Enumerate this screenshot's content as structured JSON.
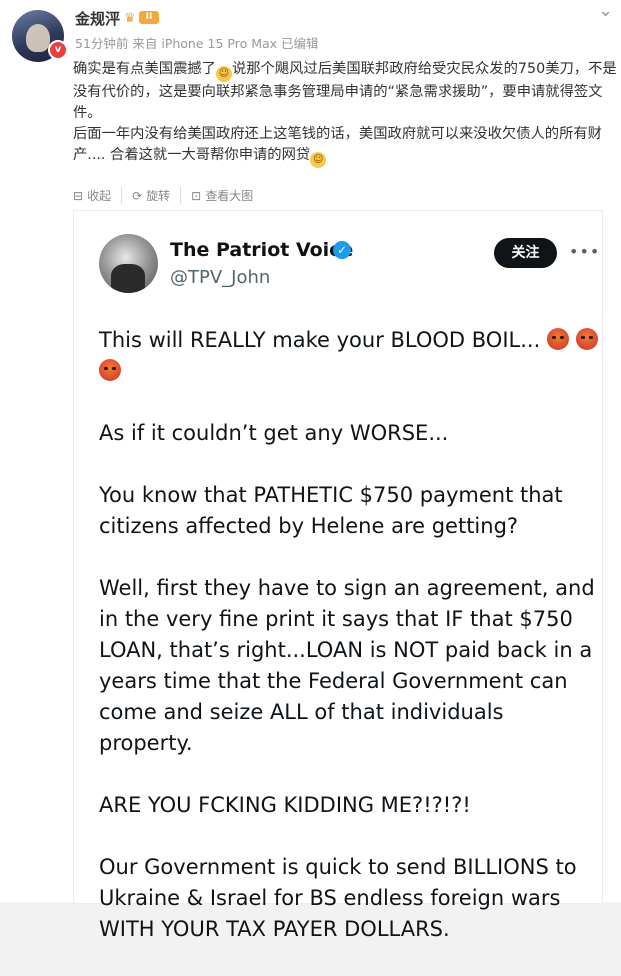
{
  "post": {
    "username": "金规泙",
    "level_badge": "II",
    "verified_badge": "v",
    "meta": "51分钟前 来自 iPhone 15 Pro Max 已编辑",
    "text": {
      "p1_a": "确实是有点美国震撼了",
      "p1_b": "说那个飓风过后美国联邦政府给受灾民众发的750美刀，不是没有代价的，这是要向联邦紧急事务管理局申请的“紧急需求援助”，要申请就得签文件。",
      "p2_a": "后面一年内没有给美国政府还上这笔钱的话，美国政府就可以来没收欠债人的所有财产.... 合着这就一大哥帮你申请的网贷"
    },
    "actions": [
      {
        "icon": "collect-icon",
        "label": "收起"
      },
      {
        "icon": "rotate-icon",
        "label": "旋转"
      },
      {
        "icon": "zoom-icon",
        "label": "查看大图"
      }
    ]
  },
  "tweet": {
    "name": "The Patriot Voice",
    "handle": "@TPV_John",
    "follow_label": "关注",
    "paragraphs": {
      "p1": "This will REALLY make your BLOOD BOIL...",
      "p2": "As if it couldn’t get any WORSE...",
      "p3": "You know that PATHETIC $750 payment that citizens affected by Helene are getting?",
      "p4": "Well, first they have to sign an agreement, and in the very fine print it says that IF that $750 LOAN, that’s right...LOAN is NOT paid back in a years time that the Federal Government can come and seize ALL of that individuals property.",
      "p5": "ARE YOU FCKING KIDDING ME?!?!?!",
      "p6": "Our Government is quick to send BILLIONS to Ukraine & Israel for BS endless foreign wars WITH YOUR TAX PAYER DOLLARS."
    }
  },
  "colors": {
    "accent": "#1d9bf0",
    "follow_bg": "#0f1419",
    "badge_red": "#e8403f",
    "level_orange": "#f4a73a"
  }
}
